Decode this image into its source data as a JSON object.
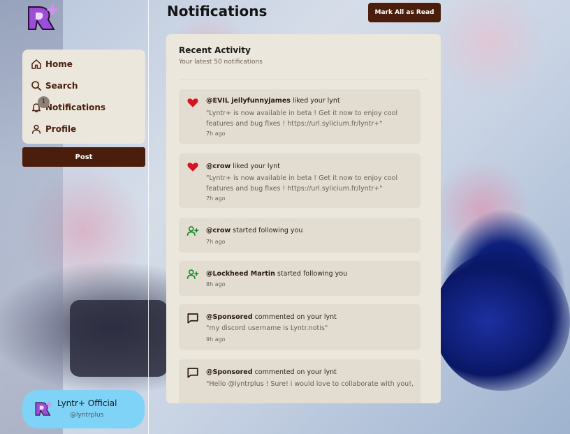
{
  "app": {
    "page_title": "Notifications",
    "mark_all_label": "Mark All as Read",
    "post_label": "Post",
    "accent": "#4a1d0c"
  },
  "sidebar": {
    "items": [
      {
        "label": "Home",
        "icon": "home-icon"
      },
      {
        "label": "Search",
        "icon": "search-icon"
      },
      {
        "label": "Notifications",
        "icon": "bell-icon"
      },
      {
        "label": "Profile",
        "icon": "user-icon"
      }
    ],
    "notif_badge": "1"
  },
  "profile": {
    "name": "Lyntr+ Official",
    "handle": "@lyntrplus"
  },
  "panel": {
    "title": "Recent Activity",
    "subtitle": "Your latest 50 notifications"
  },
  "notifications": [
    {
      "type": "like",
      "icon": "heart-icon",
      "user": "@EVIL jellyfunnyjames",
      "action": " liked your lynt",
      "quote": "\"Lyntr+ is now available in beta ! Get it now to enjoy cool features and bug fixes ! https://url.sylicium.fr/lyntr+\"",
      "time": "7h ago"
    },
    {
      "type": "like",
      "icon": "heart-icon",
      "user": "@crow",
      "action": " liked your lynt",
      "quote": "\"Lyntr+ is now available in beta ! Get it now to enjoy cool features and bug fixes ! https://url.sylicium.fr/lyntr+\"",
      "time": "7h ago"
    },
    {
      "type": "follow",
      "icon": "user-plus-icon",
      "user": "@crow",
      "action": " started following you",
      "quote": "",
      "time": "7h ago"
    },
    {
      "type": "follow",
      "icon": "user-plus-icon",
      "user": "@Lockheed Martin",
      "action": " started following you",
      "quote": "",
      "time": "8h ago"
    },
    {
      "type": "comment",
      "icon": "comment-icon",
      "user": "@Sponsored",
      "action": " commented on your lynt",
      "quote": "\"my discord username is Lyntr.notis\"",
      "time": "9h ago"
    },
    {
      "type": "comment",
      "icon": "comment-icon",
      "user": "@Sponsored",
      "action": " commented on your lynt",
      "quote": "\"Hello @lyntrplus ! Sure! i would love to collaborate with you!,",
      "time": ""
    }
  ]
}
